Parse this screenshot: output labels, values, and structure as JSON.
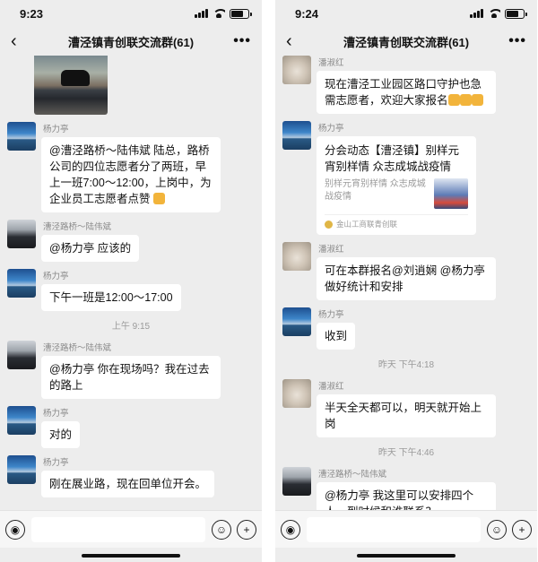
{
  "left": {
    "status": {
      "time": "9:23"
    },
    "nav": {
      "back": "‹",
      "title": "漕泾镇青创联交流群(61)",
      "more": "•••"
    },
    "messages": [
      {
        "name": "杨力亭",
        "text": "@漕泾路桥～陆伟斌 陆总，路桥公司的四位志愿者分了两班，早上一班7:00～12:00，上岗中，为企业员工志愿者点赞"
      },
      {
        "name": "漕泾路桥～陆伟斌",
        "text": "@杨力亭 应该的"
      },
      {
        "name": "杨力亭",
        "text": "下午一班是12:00～17:00"
      },
      {
        "system": "上午 9:15"
      },
      {
        "name": "漕泾路桥～陆伟斌",
        "text": "@杨力亭 你在现场吗？我在过去的路上"
      },
      {
        "name": "杨力亭",
        "text": "对的"
      },
      {
        "name": "杨力亭",
        "text": "刚在展业路，现在回单位开会。"
      }
    ]
  },
  "right": {
    "status": {
      "time": "9:24"
    },
    "nav": {
      "back": "‹",
      "title": "漕泾镇青创联交流群(61)",
      "more": "•••"
    },
    "messages": [
      {
        "name": "潘淑红",
        "text": "现在漕泾工业园区路口守护也急需志愿者，欢迎大家报名"
      },
      {
        "name": "杨力亭",
        "card": {
          "title": "分会动态【漕泾镇】别样元宵别样情 众志成城战疫情",
          "desc": "别样元宵别样情 众志成城战疫情",
          "source": "金山工商联青创联"
        }
      },
      {
        "name": "潘淑红",
        "text": "可在本群报名@刘逍娴 @杨力亭 做好统计和安排"
      },
      {
        "name": "杨力亭",
        "text": "收到"
      },
      {
        "system": "昨天 下午4:18"
      },
      {
        "name": "潘淑红",
        "text": "半天全天都可以，明天就开始上岗"
      },
      {
        "system": "昨天 下午4:46"
      },
      {
        "name": "漕泾路桥～陆伟斌",
        "text": "@杨力亭 我这里可以安排四个人，到时候和谁联系？"
      }
    ]
  },
  "colors": {
    "chat_bg": "#ededed",
    "bubble": "#ffffff",
    "meta": "#8a8a8a"
  },
  "icons": {
    "voice": "voice-icon",
    "emoji": "emoji-icon",
    "add": "add-icon"
  }
}
